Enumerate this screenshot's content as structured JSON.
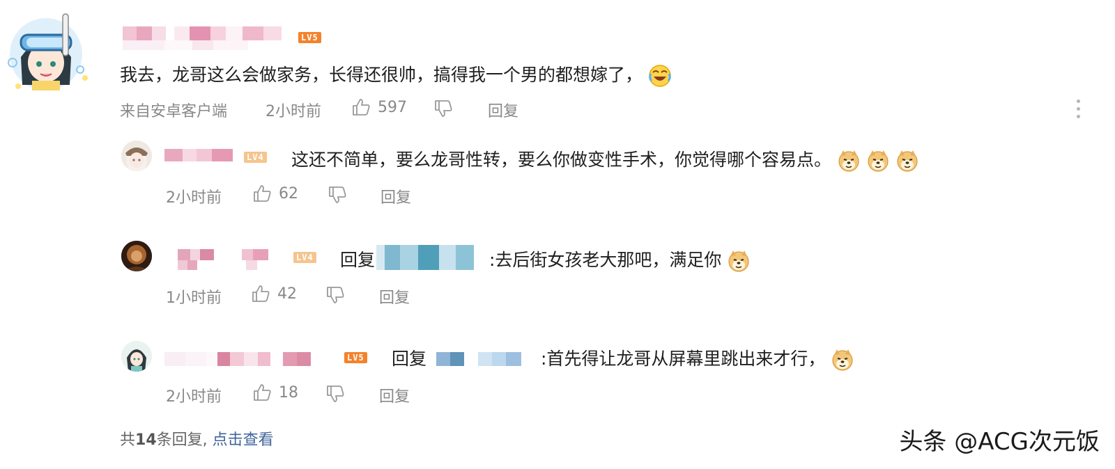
{
  "main_comment": {
    "level": "LV5",
    "text": "我去，龙哥这么会做家务，长得还很帅，搞得我一个男的都想嫁了，",
    "source": "来自安卓客户端",
    "time": "2小时前",
    "likes": "597",
    "reply_label": "回复"
  },
  "replies": [
    {
      "level": "LV4",
      "text": "这还不简单，要么龙哥性转，要么你做变性手术，你觉得哪个容易点。",
      "time": "2小时前",
      "likes": "62",
      "reply_label": "回复"
    },
    {
      "level": "LV4",
      "reply_prefix": "回复",
      "text": ":去后街女孩老大那吧，满足你",
      "time": "1小时前",
      "likes": "42",
      "reply_label": "回复"
    },
    {
      "level": "LV5",
      "reply_prefix": "回复",
      "text": ":首先得让龙哥从屏幕里跳出来才行，",
      "time": "2小时前",
      "likes": "18",
      "reply_label": "回复"
    }
  ],
  "footer": {
    "count_prefix": "共",
    "count": "14",
    "count_suffix": "条回复,",
    "view_link": "点击查看"
  },
  "watermark": "头条 @ACG次元饭",
  "colors": {
    "level_badge": "#f4822b",
    "link_blue": "#406599",
    "meta_gray": "#888888"
  }
}
